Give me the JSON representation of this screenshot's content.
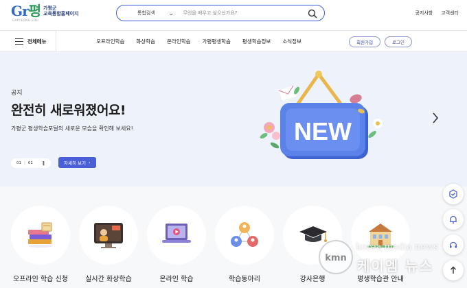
{
  "header": {
    "logo_mark_a": "Gr",
    "logo_mark_b": "평",
    "logo_sub": "GAPYEONG EDU",
    "logo_line1": "가평군",
    "logo_line2": "교육통합홈페이지",
    "search_category": "통합검색",
    "search_placeholder": "무엇을 배우고 싶으신가요?",
    "links": [
      "공지사항",
      "고객센터"
    ]
  },
  "nav": {
    "menu_all": "전체메뉴",
    "items": [
      "오프라인학습",
      "화상학습",
      "온라인학습",
      "가평평생학습",
      "평생학습정보",
      "소식정보"
    ],
    "join": "회원가입",
    "login": "로그인"
  },
  "hero": {
    "notice": "공지",
    "title": "완전히 새로워졌어요!",
    "desc": "가평군 평생학습포털의 새로운 모습을 확인해 보세요!",
    "pager_current": "01",
    "pager_total": "01",
    "detail_button": "자세히 보기",
    "sign_text": "NEW"
  },
  "quick_menu": [
    {
      "label": "오프라인 학습 신청",
      "icon": "books-icon"
    },
    {
      "label": "실시간 화상학습",
      "icon": "live-class-icon"
    },
    {
      "label": "온라인 학습",
      "icon": "laptop-video-icon"
    },
    {
      "label": "학습동아리",
      "icon": "people-network-icon"
    },
    {
      "label": "강사은행",
      "icon": "graduation-cap-icon"
    },
    {
      "label": "평생학습관 안내",
      "icon": "building-icon"
    }
  ],
  "watermark": {
    "logo": "kmn",
    "en": "korea media news",
    "ko": "케이엠 뉴스"
  },
  "colors": {
    "accent": "#4a5fd6",
    "search_border": "#3f5bd9",
    "hero_bg": "#eef3fb"
  }
}
